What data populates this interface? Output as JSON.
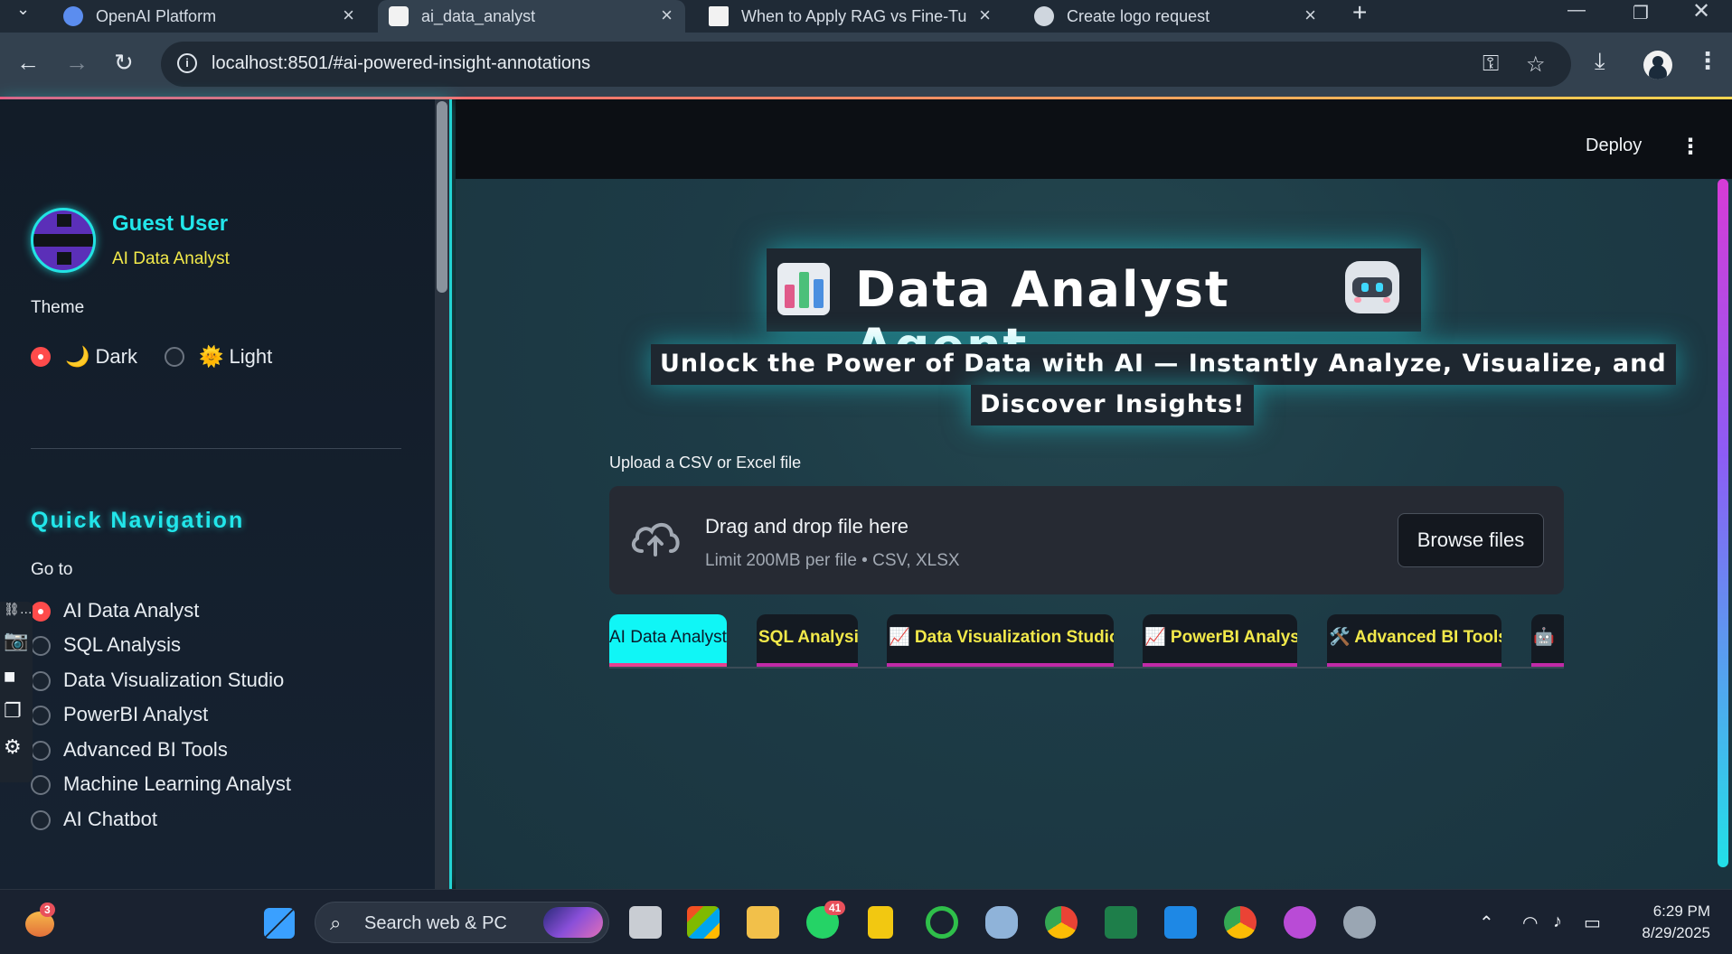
{
  "browser": {
    "tabs": [
      {
        "title": "OpenAI Platform"
      },
      {
        "title": "ai_data_analyst"
      },
      {
        "title": "When to Apply RAG vs Fine-Tur"
      },
      {
        "title": "Create logo request"
      }
    ],
    "url": "localhost:8501/#ai-powered-insight-annotations"
  },
  "sidebar": {
    "user_name": "Guest User",
    "user_role": "AI Data Analyst",
    "theme_label": "Theme",
    "theme_options": [
      {
        "label": "🌙 Dark",
        "selected": true
      },
      {
        "label": "🌞 Light",
        "selected": false
      }
    ],
    "quick_nav_title": "Quick Navigation",
    "goto_label": "Go to",
    "nav_options": [
      {
        "label": "AI Data Analyst",
        "selected": true
      },
      {
        "label": "SQL Analysis",
        "selected": false
      },
      {
        "label": "Data Visualization Studio",
        "selected": false
      },
      {
        "label": "PowerBI Analyst",
        "selected": false
      },
      {
        "label": "Advanced BI Tools",
        "selected": false
      },
      {
        "label": "Machine Learning Analyst",
        "selected": false
      },
      {
        "label": "AI Chatbot",
        "selected": false
      }
    ]
  },
  "header": {
    "deploy_label": "Deploy",
    "menu_icon": "⋮"
  },
  "main": {
    "title": "Data Analyst Agent",
    "subtitle_line1": "Unlock the Power of Data with AI — Instantly Analyze, Visualize, and",
    "subtitle_line2": "Discover Insights!",
    "upload_label": "Upload a CSV or Excel file",
    "dropzone_title": "Drag and drop file here",
    "dropzone_sub": "Limit 200MB per file • CSV, XLSX",
    "browse_label": "Browse files",
    "tabs": [
      {
        "label": "AI Data Analyst",
        "active": true
      },
      {
        "label": "SQL Analysis",
        "active": false
      },
      {
        "label": "📈 Data Visualization Studio",
        "active": false
      },
      {
        "label": "📈 PowerBI Analyst",
        "active": false
      },
      {
        "label": "🛠️ Advanced BI Tools",
        "active": false
      },
      {
        "label": "🤖",
        "active": false
      }
    ]
  },
  "taskbar": {
    "search_placeholder": "Search web & PC",
    "store_badge": "3",
    "whatsapp_badge": "41",
    "time": "6:29 PM",
    "date": "8/29/2025"
  },
  "colors": {
    "accent_cyan": "#22e6ea",
    "accent_yellow": "#f2e94a",
    "radio_selected": "#ff4b4b"
  }
}
